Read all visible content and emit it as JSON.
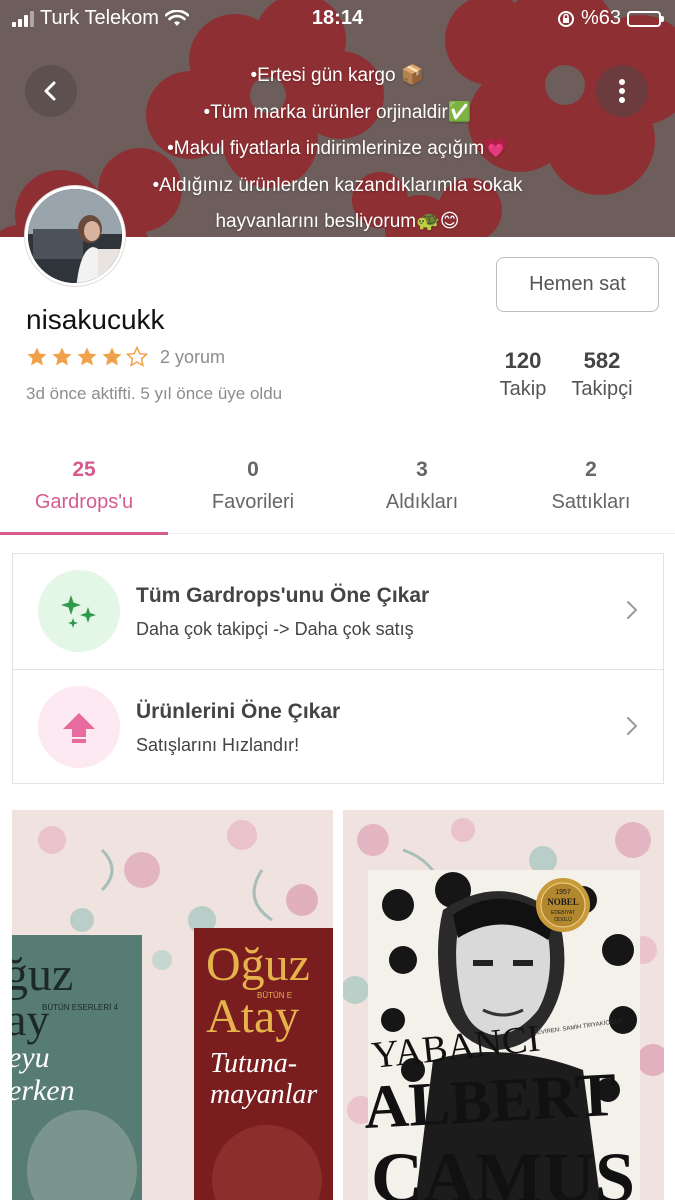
{
  "status_bar": {
    "carrier": "Turk Telekom",
    "time": "18:14",
    "battery": "%63",
    "battery_level": 0.63
  },
  "bio": {
    "lines": [
      "•Ertesi gün kargo 📦",
      "•Tüm marka ürünler orjinaldir✅",
      "•Makul fiyatlarla indirimlerinize açığım💗",
      "•Aldığınız ürünlerden kazandıklarımla sokak",
      "hayvanlarını besliyorum🐢😊"
    ]
  },
  "profile": {
    "username": "nisakucukk",
    "rating": 4,
    "reviews": "2 yorum",
    "activity": "3d önce aktifti. 5 yıl önce üye oldu",
    "sell_button": "Hemen sat",
    "following_count": "120",
    "following_label": "Takip",
    "followers_count": "582",
    "followers_label": "Takipçi"
  },
  "tabs": [
    {
      "count": "25",
      "label": "Gardrops'u",
      "active": true
    },
    {
      "count": "0",
      "label": "Favorileri",
      "active": false
    },
    {
      "count": "3",
      "label": "Aldıkları",
      "active": false
    },
    {
      "count": "2",
      "label": "Sattıkları",
      "active": false
    }
  ],
  "promos": [
    {
      "title": "Tüm Gardrops'unu Öne Çıkar",
      "subtitle": "Daha çok takipçi -> Daha çok satış",
      "icon": "sparkle-icon",
      "color": "#2e9a4a"
    },
    {
      "title": "Ürünlerini Öne Çıkar",
      "subtitle": "Satışlarını Hızlandır!",
      "icon": "arrow-up-icon",
      "color": "#e76b9c"
    }
  ],
  "products": [
    {
      "books": [
        {
          "author": "ğuz",
          "author2": "ay",
          "series": "BÜTÜN ESERLERİ 4",
          "title1": "eyu",
          "title2": "erken"
        },
        {
          "author": "Oğuz",
          "author2": "Atay",
          "series": "BÜTÜN E",
          "title1": "Tutuna-",
          "title2": "mayanlar"
        }
      ]
    },
    {
      "books": [
        {
          "title": "YABANCI",
          "author1": "ALBERT",
          "author2": "CAMUS",
          "badge_year": "1957",
          "badge_line1": "NOBEL",
          "badge_line2": "EDEBİYAT",
          "badge_line3": "ÖDÜLÜ",
          "translator": "ÇEVİREN: SAMİH TİRYAKİOĞLU"
        }
      ]
    }
  ],
  "colors": {
    "accent": "#d55a8d",
    "banner": "#6a5b59",
    "star": "#f0a24a"
  }
}
